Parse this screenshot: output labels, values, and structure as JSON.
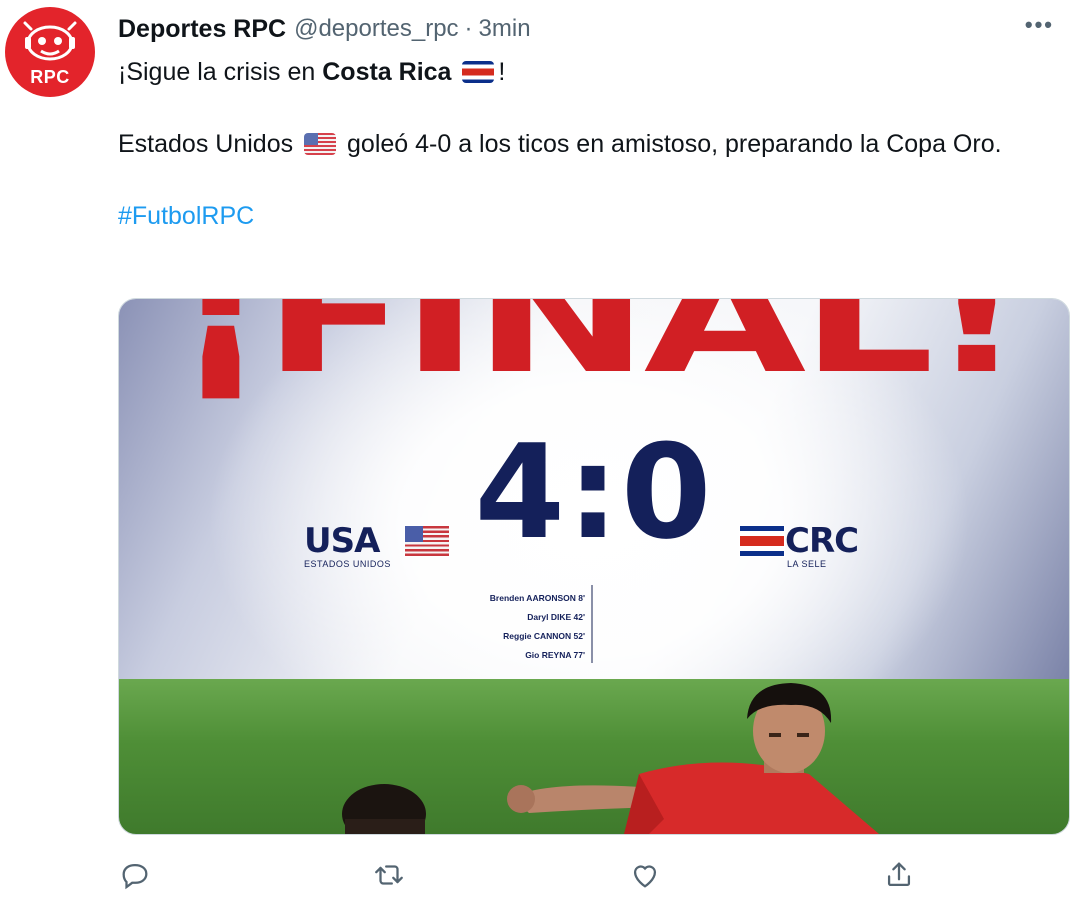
{
  "author": {
    "avatar_text": "RPC",
    "display_name": "Deportes RPC",
    "handle": "@deportes_rpc",
    "separator": "·",
    "timestamp": "3min"
  },
  "more_icon": "more-horizontal-icon",
  "text": {
    "line1_prefix": "¡Sigue la crisis en ",
    "line1_bold": "Costa Rica",
    "line1_suffix": "!",
    "line2_prefix": "Estados Unidos",
    "line2_suffix": " goleó 4-0 a los ticos en amistoso, preparando la Copa Oro.",
    "hashtag": "#FutbolRPC"
  },
  "media": {
    "title": "¡FINAL!",
    "score": "4:0",
    "home": {
      "name": "USA",
      "subtitle": "ESTADOS UNIDOS"
    },
    "away": {
      "name": "CRC",
      "subtitle": "LA SELE"
    },
    "scorers": [
      "Brenden AARONSON 8'",
      "Daryl DIKE 42'",
      "Reggie CANNON 52'",
      "Gio REYNA 77'"
    ]
  },
  "actions": [
    "reply-icon",
    "retweet-icon",
    "like-icon",
    "share-icon"
  ],
  "colors": {
    "brand_red": "#d11f24",
    "navy": "#14205a",
    "link_blue": "#1d9bf0",
    "muted": "#536471"
  }
}
